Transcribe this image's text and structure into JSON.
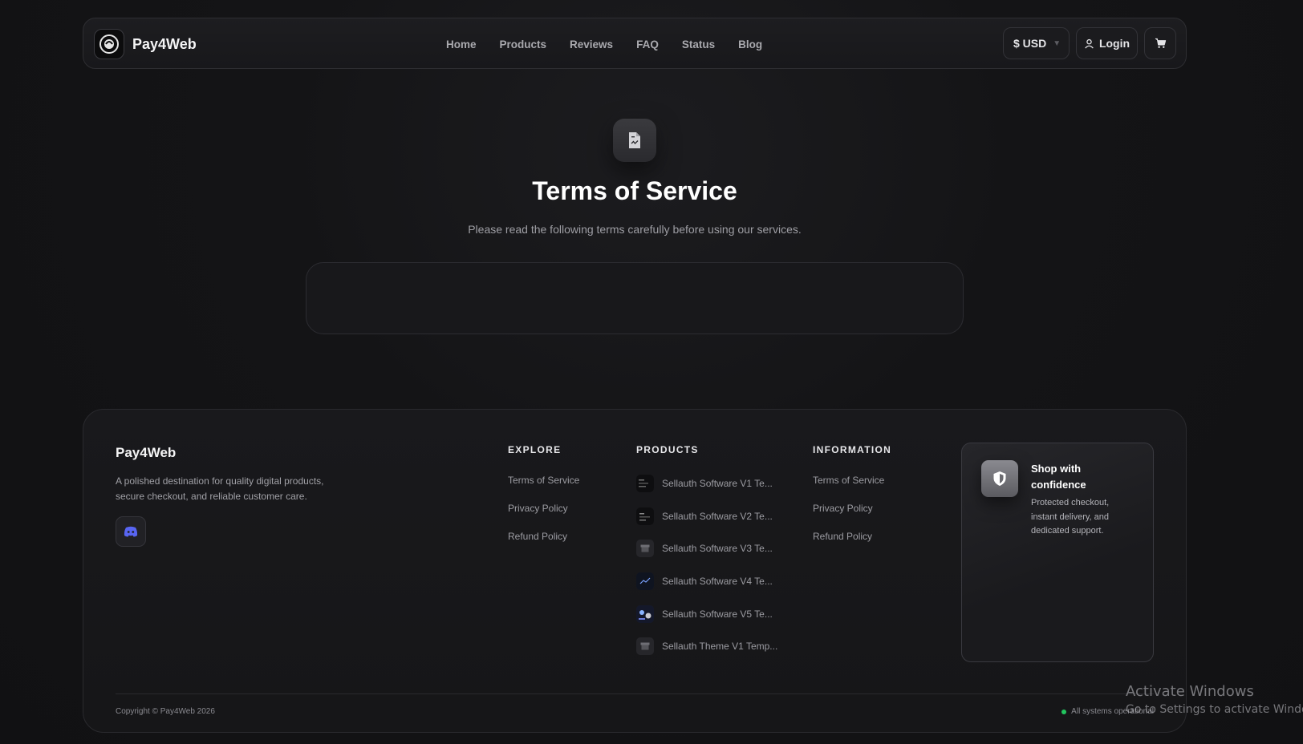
{
  "header": {
    "brand": "Pay4Web",
    "nav": [
      "Home",
      "Products",
      "Reviews",
      "FAQ",
      "Status",
      "Blog"
    ],
    "currency": "$ USD",
    "login": "Login"
  },
  "hero": {
    "title": "Terms of Service",
    "subtitle": "Please read the following terms carefully before using our services."
  },
  "footer": {
    "brand": "Pay4Web",
    "description": "A polished destination for quality digital products, secure checkout, and reliable customer care.",
    "explore": {
      "heading": "EXPLORE",
      "links": [
        "Terms of Service",
        "Privacy Policy",
        "Refund Policy"
      ]
    },
    "products": {
      "heading": "PRODUCTS",
      "items": [
        "Sellauth Software V1 Te...",
        "Sellauth Software V2 Te...",
        "Sellauth Software V3 Te...",
        "Sellauth Software V4 Te...",
        "Sellauth Software V5 Te...",
        "Sellauth Theme V1 Temp..."
      ]
    },
    "information": {
      "heading": "INFORMATION",
      "links": [
        "Terms of Service",
        "Privacy Policy",
        "Refund Policy"
      ]
    },
    "confidence": {
      "title": "Shop with confidence",
      "description": "Protected checkout, instant delivery, and dedicated support."
    },
    "copyright": "Copyright © Pay4Web 2026",
    "status": "All systems operational"
  },
  "watermark": {
    "title": "Activate Windows",
    "subtitle": "Go to Settings to activate Windows."
  },
  "colors": {
    "status_green": "#22c55e",
    "discord": "#5865f2"
  }
}
